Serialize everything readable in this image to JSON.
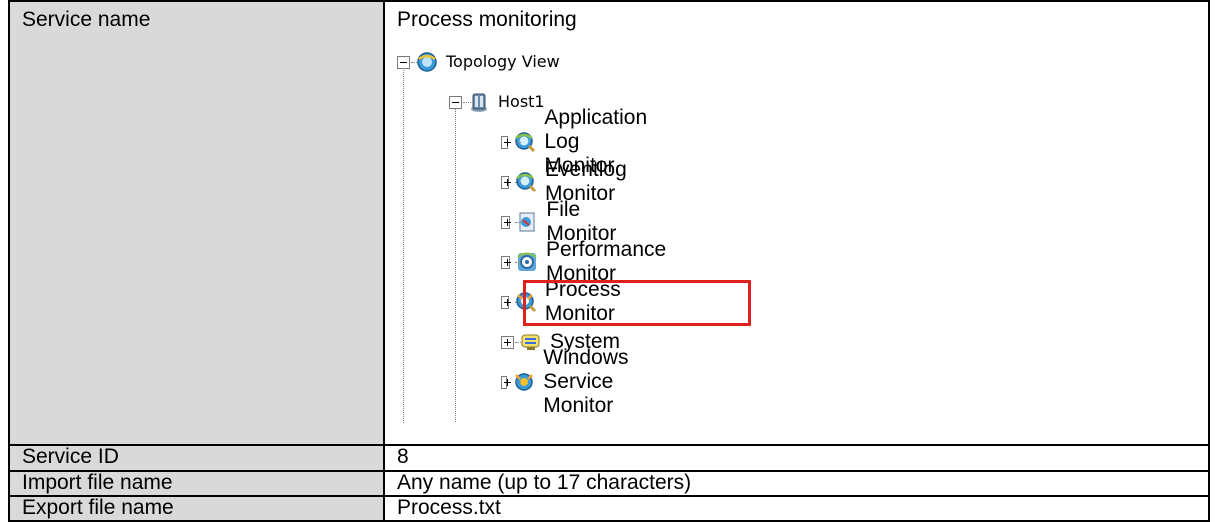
{
  "rows": [
    {
      "label": "Service name",
      "value": "Process monitoring"
    },
    {
      "label": "Service ID",
      "value": "8"
    },
    {
      "label": "Import file name",
      "value": "Any name (up to 17 characters)"
    },
    {
      "label": "Export file name",
      "value": "Process.txt"
    }
  ],
  "tree": {
    "root": {
      "label": "Topology View",
      "icon": "topology-icon",
      "expanded": true
    },
    "host": {
      "label": "Host1",
      "icon": "server-icon",
      "expanded": true
    },
    "children": [
      {
        "label": "Application Log Monitor",
        "icon": "monitor-icon"
      },
      {
        "label": "Eventlog Monitor",
        "icon": "monitor-icon"
      },
      {
        "label": "File Monitor",
        "icon": "file-monitor-icon"
      },
      {
        "label": "Performance Monitor",
        "icon": "performance-icon"
      },
      {
        "label": "Process Monitor",
        "icon": "process-icon",
        "highlighted": true
      },
      {
        "label": "System",
        "icon": "system-icon"
      },
      {
        "label": "Windows Service Monitor",
        "icon": "service-icon"
      }
    ]
  },
  "colors": {
    "label_bg": "#d9d9d9",
    "highlight": "#e0201e"
  }
}
